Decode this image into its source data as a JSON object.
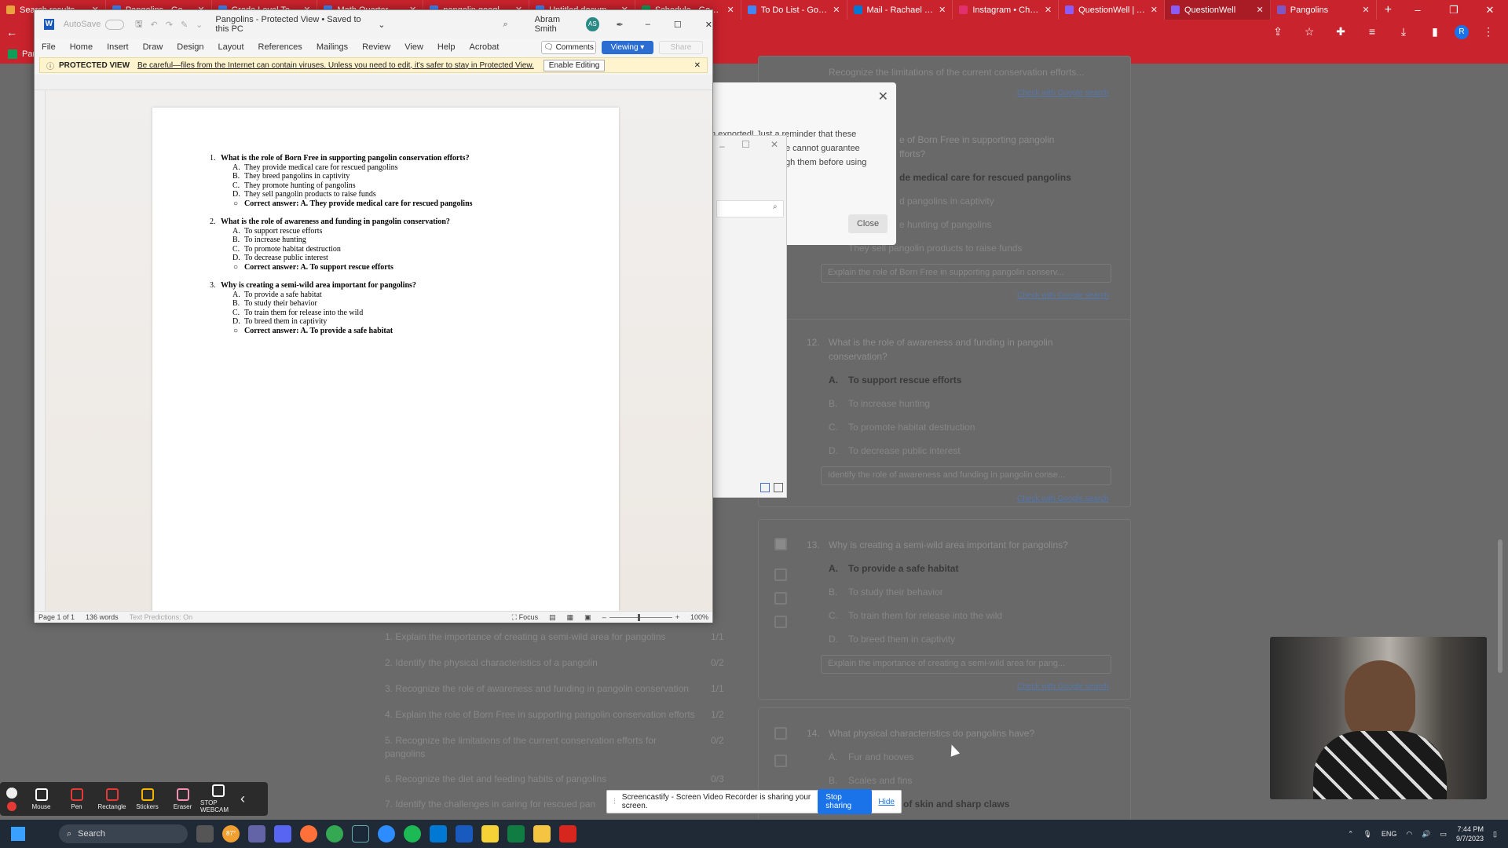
{
  "chrome": {
    "tabs": [
      {
        "label": "Search results - Goo",
        "color": "#e8a33c"
      },
      {
        "label": "Pangolins - Google D",
        "color": "#4285f4"
      },
      {
        "label": "Grade Level Teams -",
        "color": "#4285f4"
      },
      {
        "label": "Math Quarter Score -",
        "color": "#4285f4"
      },
      {
        "label": "pangolin google search",
        "color": "#4285f4"
      },
      {
        "label": "Untitled document -",
        "color": "#4285f4"
      },
      {
        "label": "Schedule - Google S",
        "color": "#0f9d58"
      },
      {
        "label": "To Do List - Google",
        "color": "#4285f4"
      },
      {
        "label": "Mail - Rachael Horne",
        "color": "#0078d4"
      },
      {
        "label": "Instagram • Chats",
        "color": "#e1306c"
      },
      {
        "label": "QuestionWell | AI for",
        "color": "#8b5cf6"
      },
      {
        "label": "QuestionWell",
        "color": "#8b5cf6"
      },
      {
        "label": "Pangolins",
        "color": "#7e57c2"
      }
    ],
    "active_tab_index": 11,
    "bookmark_label": "Pan"
  },
  "word": {
    "autosave_label": "AutoSave",
    "title": "Pangolins - Protected View • Saved to this PC",
    "user_name": "Abram Smith",
    "user_initials": "AS",
    "menu": [
      "File",
      "Home",
      "Insert",
      "Draw",
      "Design",
      "Layout",
      "References",
      "Mailings",
      "Review",
      "View",
      "Help",
      "Acrobat"
    ],
    "comments_label": "Comments",
    "viewing_label": "Viewing",
    "share_label": "Share",
    "banner_title": "PROTECTED VIEW",
    "banner_text": "Be careful—files from the Internet can contain viruses. Unless you need to edit, it's safer to stay in Protected View.",
    "enable_editing_label": "Enable Editing",
    "status": {
      "page": "Page 1 of 1",
      "words": "136 words",
      "predictions": "Text Predictions: On",
      "focus": "Focus",
      "zoom": "100%"
    },
    "questions": [
      {
        "num": "1.",
        "text": "What is the role of Born Free in supporting pangolin conservation efforts?",
        "options": [
          {
            "letter": "A.",
            "text": "They provide medical care for rescued pangolins"
          },
          {
            "letter": "B.",
            "text": "They breed pangolins in captivity"
          },
          {
            "letter": "C.",
            "text": "They promote hunting of pangolins"
          },
          {
            "letter": "D.",
            "text": "They sell pangolin products to raise funds"
          }
        ],
        "answer": "Correct answer: A. They provide medical care for rescued pangolins"
      },
      {
        "num": "2.",
        "text": "What is the role of awareness and funding in pangolin conservation?",
        "options": [
          {
            "letter": "A.",
            "text": "To support rescue efforts"
          },
          {
            "letter": "B.",
            "text": "To increase hunting"
          },
          {
            "letter": "C.",
            "text": "To promote habitat destruction"
          },
          {
            "letter": "D.",
            "text": "To decrease public interest"
          }
        ],
        "answer": "Correct answer: A. To support rescue efforts"
      },
      {
        "num": "3.",
        "text": "Why is creating a semi-wild area important for pangolins?",
        "options": [
          {
            "letter": "A.",
            "text": "To provide a safe habitat"
          },
          {
            "letter": "B.",
            "text": "To study their behavior"
          },
          {
            "letter": "C.",
            "text": "To train them for release into the wild"
          },
          {
            "letter": "D.",
            "text": "To breed them in captivity"
          }
        ],
        "answer": "Correct answer: A. To provide a safe habitat"
      }
    ]
  },
  "dialog": {
    "text_lines": [
      "n exported! Just a reminder that these",
      "e cannot guarantee",
      "gh them before using"
    ],
    "close_label": "Close"
  },
  "background": {
    "top_text": "Recognize the limitations of the current conservation efforts...",
    "link_text": "Check with Google search",
    "q11_line1": "e of Born Free in supporting pangolin",
    "q11_line2": "fforts?",
    "q11_answer": "de medical care for rescued pangolins",
    "q11_opt_b": "d pangolins in captivity",
    "q11_opt_c": "e hunting of pangolins",
    "q11_opt_d": "They sell pangolin products to raise funds",
    "q11_input": "Explain the role of Born Free in supporting pangolin conserv...",
    "q12_num": "12.",
    "q12_line1": "What is the role of awareness and funding in pangolin",
    "q12_line2": "conservation?",
    "q12_answer": "To support rescue efforts",
    "q12_opt_b": "To increase hunting",
    "q12_opt_c": "To promote habitat destruction",
    "q12_opt_d": "To decrease public interest",
    "q12_input": "Identify the role of awareness and funding in pangolin conse...",
    "q13_num": "13.",
    "q13_text": "Why is creating a semi-wild area important for pangolins?",
    "q13_answer": "To provide a safe habitat",
    "q13_opt_b": "To study their behavior",
    "q13_opt_c": "To train them for release into the wild",
    "q13_opt_d": "To breed them in captivity",
    "q13_input": "Explain the importance of creating a semi-wild area for pang...",
    "q14_num": "14.",
    "q14_text": "What physical characteristics do pangolins have?",
    "q14_opt_a": "Fur and hooves",
    "q14_opt_b": "Scales and fins",
    "q14_opt_c": "of skin and sharp claws",
    "objectives": [
      {
        "text": "1. Explain the importance of creating a semi-wild area for pangolins",
        "count": "1/1"
      },
      {
        "text": "2. Identify the physical characteristics of a pangolin",
        "count": "0/2"
      },
      {
        "text": "3. Recognize the role of awareness and funding in pangolin conservation",
        "count": "1/1"
      },
      {
        "text": "4. Explain the role of Born Free in supporting pangolin conservation efforts",
        "count": "1/2"
      },
      {
        "text": "5. Recognize the limitations of the current conservation efforts for",
        "text2": "pangolins",
        "count": "0/2"
      },
      {
        "text": "6. Recognize the diet and feeding habits of pangolins",
        "count": "0/3"
      },
      {
        "text": "7. Identify the challenges in caring for rescued pan",
        "count": ""
      }
    ]
  },
  "recorder": {
    "tools": [
      "Mouse",
      "Pen",
      "Rectangle",
      "Stickers",
      "Eraser",
      "STOP WEBCAM"
    ]
  },
  "share_bar": {
    "text": "Screencastify - Screen Video Recorder is sharing your screen.",
    "stop_label": "Stop sharing",
    "hide_label": "Hide"
  },
  "taskbar": {
    "search_placeholder": "Search",
    "weather": "87°",
    "lang": "ENG",
    "time": "7:44 PM",
    "date": "9/7/2023"
  }
}
